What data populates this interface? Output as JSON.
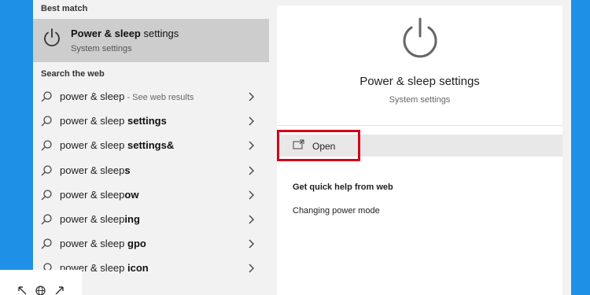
{
  "left_panel": {
    "best_match_heading": "Best match",
    "best_match": {
      "icon": "power-icon",
      "title_bold": "Power & sleep",
      "title_rest": " settings",
      "subtitle": "System settings"
    },
    "search_web_heading": "Search the web",
    "web_results": [
      {
        "prefix": "power & sleep",
        "bold": "",
        "suffix": " - See web results"
      },
      {
        "prefix": "power & sleep ",
        "bold": "settings",
        "suffix": ""
      },
      {
        "prefix": "power & sleep ",
        "bold": "settings&",
        "suffix": ""
      },
      {
        "prefix": "power & sleep",
        "bold": "s",
        "suffix": ""
      },
      {
        "prefix": "power & sleep",
        "bold": "ow",
        "suffix": ""
      },
      {
        "prefix": "power & sleep",
        "bold": "ing",
        "suffix": ""
      },
      {
        "prefix": "power & sleep ",
        "bold": "gpo",
        "suffix": ""
      },
      {
        "prefix": "power & sleep ",
        "bold": "icon",
        "suffix": ""
      }
    ]
  },
  "right_panel": {
    "icon": "power-icon",
    "title": "Power & sleep settings",
    "subtitle": "System settings",
    "open_label": "Open",
    "help_heading": "Get quick help from web",
    "help_link": "Changing power mode"
  },
  "colors": {
    "desktop": "#1e90e6",
    "panel": "#f2f2f2",
    "selected": "#cdcdcd",
    "highlight_border": "#d0021b"
  }
}
